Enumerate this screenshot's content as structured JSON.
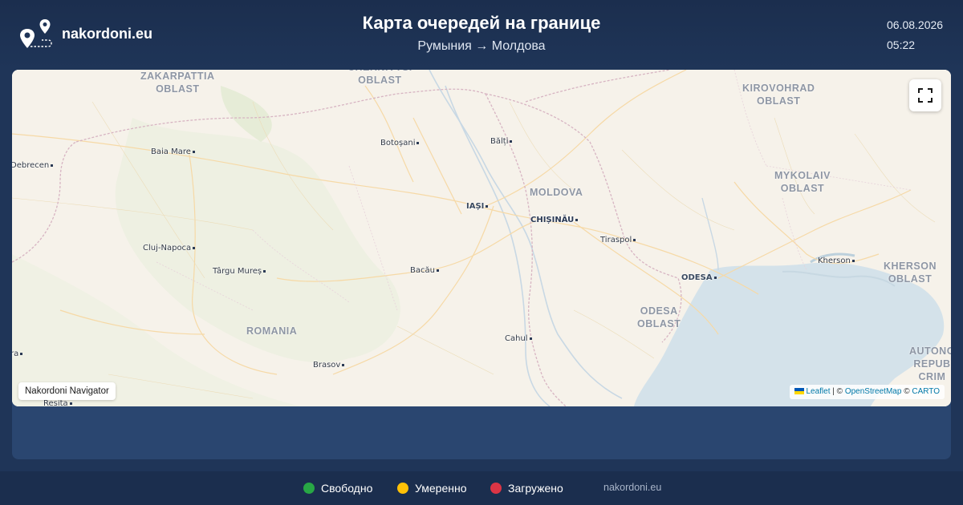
{
  "header": {
    "brand": "nakordoni.eu",
    "title": "Карта очередей на границе",
    "route": "Румыния → Молдова",
    "date": "06.08.2026",
    "time": "05:22"
  },
  "map": {
    "places": [
      {
        "name": "Botoșani",
        "kind": "city"
      },
      {
        "name": "Bălți",
        "kind": "city"
      },
      {
        "name": "Baia Mare",
        "kind": "city"
      },
      {
        "name": "Debrecen",
        "kind": "city"
      },
      {
        "name": "Iași",
        "kind": "city"
      },
      {
        "name": "Chișinău",
        "kind": "capital"
      },
      {
        "name": "Tiraspol",
        "kind": "city"
      },
      {
        "name": "Cluj-Napoca",
        "kind": "city"
      },
      {
        "name": "Târgu Mureș",
        "kind": "city"
      },
      {
        "name": "Bacău",
        "kind": "city"
      },
      {
        "name": "Kherson",
        "kind": "city"
      },
      {
        "name": "Odesa",
        "kind": "city"
      },
      {
        "name": "Cahul",
        "kind": "city"
      },
      {
        "name": "Brasov",
        "kind": "city"
      },
      {
        "name": "Resita",
        "kind": "city"
      },
      {
        "name": "ra",
        "kind": "city"
      }
    ],
    "regions": [
      {
        "name": "ZAKARPATTIA\nOBLAST"
      },
      {
        "name": "CHERNIVTSI\nOBLAST"
      },
      {
        "name": "KIROVOHRAD\nOBLAST"
      },
      {
        "name": "MOLDOVA"
      },
      {
        "name": "MYKOLAIV\nOBLAST"
      },
      {
        "name": "KHERSON\nOBLAST"
      },
      {
        "name": "ODESA\nOBLAST"
      },
      {
        "name": "ROMANIA"
      },
      {
        "name": "AUTONO\nREPUB\nCRIM"
      }
    ],
    "navigator_label": "Nakordoni Navigator",
    "attribution": {
      "leaflet": "Leaflet",
      "sep1": " | © ",
      "osm": "OpenStreetMap",
      "sep2": " © ",
      "carto": "CARTO"
    },
    "fullscreen_icon": "fullscreen-icon"
  },
  "legend": [
    {
      "label": "Свободно",
      "color": "#28a745"
    },
    {
      "label": "Умеренно",
      "color": "#ffc107"
    },
    {
      "label": "Загружено",
      "color": "#dc3545"
    }
  ],
  "footer": {
    "site": "nakordoni.eu"
  }
}
